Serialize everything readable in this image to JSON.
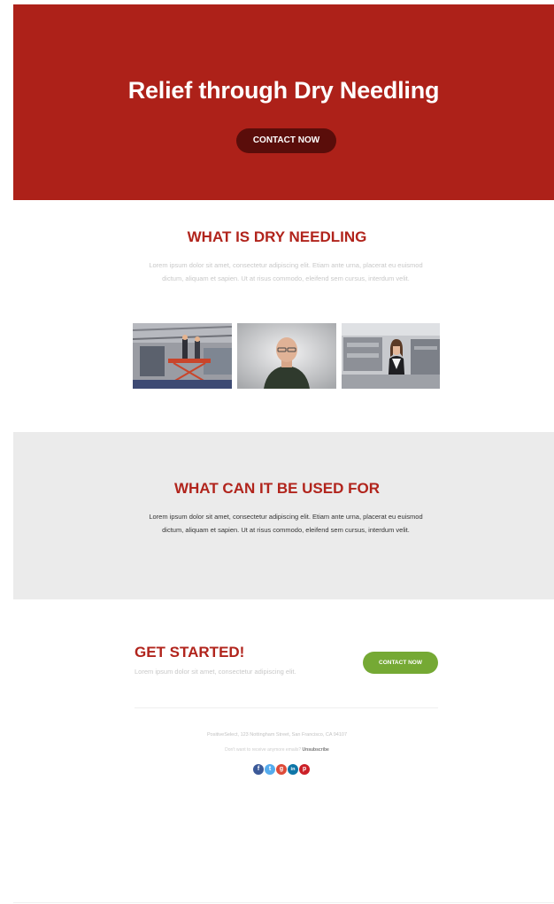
{
  "hero": {
    "title": "Relief through Dry Needling",
    "cta_label": "CONTACT NOW",
    "background": "#ad2119",
    "button_color": "#5a0d0a"
  },
  "what_is": {
    "title": "WHAT IS DRY NEEDLING",
    "body": "Lorem ipsum dolor sit amet, consectetur adipiscing elit. Etiam ante urna, placerat eu euismod dictum, aliquam et sapien. Ut at risus commodo, eleifend sem cursus, interdum velit.",
    "images": [
      {
        "name": "workers-on-lift-photo"
      },
      {
        "name": "bald-man-portrait-photo"
      },
      {
        "name": "woman-in-factory-photo"
      }
    ]
  },
  "used_for": {
    "title": "WHAT CAN IT BE USED FOR",
    "body": "Lorem ipsum dolor sit amet, consectetur adipiscing elit. Etiam ante urna, placerat eu euismod dictum, aliquam et sapien. Ut at risus commodo, eleifend sem cursus, interdum velit.",
    "background": "#ebebeb"
  },
  "get_started": {
    "title": "GET STARTED!",
    "body": "Lorem ipsum dolor sit amet, consectetur adipiscing elit.",
    "cta_label": "CONTACT NOW",
    "button_color": "#75a934"
  },
  "footer": {
    "address": "PositiveSelect, 123 Nottingham Street, San Francisco, CA 94107",
    "unsubscribe_prompt": "Don't want to receive anymore emails?",
    "unsubscribe_label": "Unsubscribe",
    "social": [
      {
        "icon": "facebook-icon",
        "glyph": "f",
        "color": "#3b5998"
      },
      {
        "icon": "twitter-icon",
        "glyph": "t",
        "color": "#55acee"
      },
      {
        "icon": "google-plus-icon",
        "glyph": "g",
        "color": "#dd4b39"
      },
      {
        "icon": "linkedin-icon",
        "glyph": "in",
        "color": "#0e76a8"
      },
      {
        "icon": "pinterest-icon",
        "glyph": "p",
        "color": "#cb2027"
      }
    ]
  }
}
